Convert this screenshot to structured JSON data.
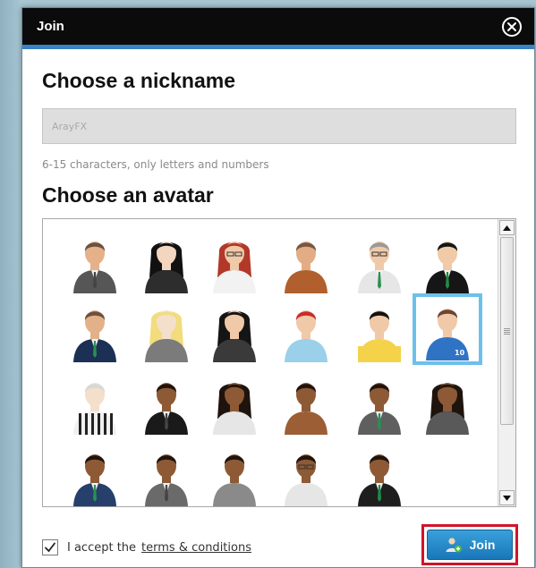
{
  "dialog": {
    "title": "Join",
    "close_icon": "close-circle-icon"
  },
  "nickname": {
    "heading": "Choose a nickname",
    "placeholder": "ArayFX",
    "value": "",
    "hint": "6-15 characters, only letters and numbers"
  },
  "avatars": {
    "heading": "Choose an avatar",
    "selected_index": 11,
    "items": [
      {
        "id": "avatar-1",
        "skin": "#e6b088",
        "hair": "#6b5141",
        "shirt": "#565656",
        "style": "suit-grey"
      },
      {
        "id": "avatar-2",
        "skin": "#f2d6c0",
        "hair": "#111111",
        "shirt": "#2d2d2d",
        "style": "long-hair"
      },
      {
        "id": "avatar-3",
        "skin": "#f0c9a8",
        "hair": "#b2382a",
        "shirt": "#f2f2f2",
        "style": "redhead-glasses"
      },
      {
        "id": "avatar-4",
        "skin": "#e2ad85",
        "hair": "#7a5642",
        "shirt": "#b15f2c",
        "style": "casual"
      },
      {
        "id": "avatar-5",
        "skin": "#f0caa8",
        "hair": "#9a9a9a",
        "shirt": "#e6e6e6",
        "style": "tie-glasses"
      },
      {
        "id": "avatar-6",
        "skin": "#f1caa8",
        "hair": "#151515",
        "shirt": "#161616",
        "style": "suit-green-tie"
      },
      {
        "id": "avatar-7",
        "skin": "#e3b189",
        "hair": "#6f4f3d",
        "shirt": "#1c2f55",
        "style": "suit-navy"
      },
      {
        "id": "avatar-8",
        "skin": "#f4dfcc",
        "hair": "#f2dc7c",
        "shirt": "#7b7b7b",
        "style": "blonde"
      },
      {
        "id": "avatar-9",
        "skin": "#f0c9a8",
        "hair": "#151515",
        "shirt": "#3a3a3a",
        "style": "bob"
      },
      {
        "id": "avatar-10",
        "skin": "#f0c9a8",
        "hair": "#cc2b2b",
        "shirt": "#9ad0e9",
        "style": "red-hair-casual"
      },
      {
        "id": "avatar-11",
        "skin": "#f0c9a8",
        "hair": "#111111",
        "shirt": "#f4d34b",
        "style": "basketball"
      },
      {
        "id": "avatar-12",
        "skin": "#f0c9a8",
        "hair": "#6e4330",
        "shirt": "#2f74c4",
        "style": "jersey-10"
      },
      {
        "id": "avatar-13",
        "skin": "#f4dfcc",
        "hair": "#d8d8d8",
        "shirt": "#f0f0f0",
        "style": "referee"
      },
      {
        "id": "avatar-14",
        "skin": "#8d5a35",
        "hair": "#1f140d",
        "shirt": "#1a1a1a",
        "style": "dark-suit"
      },
      {
        "id": "avatar-15",
        "skin": "#8d5a35",
        "hair": "#1f140d",
        "shirt": "#e6e6e6",
        "style": "dark-long-hair"
      },
      {
        "id": "avatar-16",
        "skin": "#8d5a35",
        "hair": "#1f140d",
        "shirt": "#9c5e34",
        "style": "dark-casual"
      },
      {
        "id": "avatar-17",
        "skin": "#8d5a35",
        "hair": "#1f140d",
        "shirt": "#5f5f5f",
        "style": "dark-tie"
      },
      {
        "id": "avatar-18",
        "skin": "#8d5a35",
        "hair": "#1f140d",
        "shirt": "#595959",
        "style": "dark-woman"
      },
      {
        "id": "avatar-19",
        "skin": "#8d5a35",
        "hair": "#1f140d",
        "shirt": "#263f6b",
        "style": "dark-navy"
      },
      {
        "id": "avatar-20",
        "skin": "#8d5a35",
        "hair": "#1f140d",
        "shirt": "#6a6a6a",
        "style": "dark-jacket"
      },
      {
        "id": "avatar-21",
        "skin": "#8d5a35",
        "hair": "#1f140d",
        "shirt": "#8a8a8a",
        "style": "dark-grey"
      },
      {
        "id": "avatar-22",
        "skin": "#8d5a35",
        "hair": "#1f140d",
        "shirt": "#e6e6e6",
        "style": "dark-glasses"
      },
      {
        "id": "avatar-23",
        "skin": "#8d5a35",
        "hair": "#1f140d",
        "shirt": "#1e1e1e",
        "style": "dark-suit-green"
      }
    ]
  },
  "footer": {
    "accept_checked": true,
    "accept_prefix": "I accept the",
    "terms_link": "terms & conditions",
    "join_label": "Join",
    "join_icon": "user-add-icon"
  },
  "colors": {
    "title_bar": "#0b0b0b",
    "accent_blue": "#3a82c4",
    "selected_avatar_border": "#6cc1eb",
    "join_button": "#1f87c7",
    "highlight_red": "#d0142a"
  }
}
